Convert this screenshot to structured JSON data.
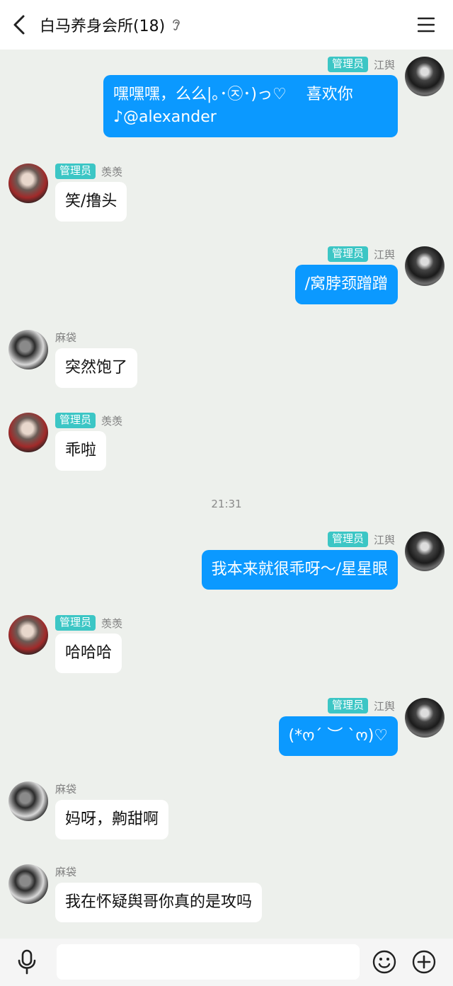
{
  "header": {
    "title": "白马养身会所(18)",
    "back_icon": "chevron-left-icon",
    "ear_icon": "ear-icon",
    "menu_icon": "hamburger-menu-icon"
  },
  "messages": [
    {
      "side": "right",
      "badge": "管理员",
      "name": "江舆",
      "text": "嘿嘿嘿，么么|｡･㉨･)っ♡    喜欢你\n♪@alexander"
    },
    {
      "side": "left",
      "badge": "管理员",
      "name": "羡羡",
      "text": "笑/撸头"
    },
    {
      "side": "right",
      "badge": "管理员",
      "name": "江舆",
      "text": "/窝脖颈蹭蹭"
    },
    {
      "side": "left",
      "name": "麻袋",
      "text": "突然饱了"
    },
    {
      "side": "left",
      "badge": "管理员",
      "name": "羡羡",
      "text": "乖啦"
    },
    {
      "side": "right",
      "badge": "管理员",
      "name": "江舆",
      "text": "我本来就很乖呀～/星星眼"
    },
    {
      "side": "left",
      "badge": "管理员",
      "name": "羡羡",
      "text": "哈哈哈"
    },
    {
      "side": "right",
      "badge": "管理员",
      "name": "江舆",
      "text": "(*ო´ ︶ `ო)♡"
    },
    {
      "side": "left",
      "name": "麻袋",
      "text": "妈呀，齁甜啊"
    },
    {
      "side": "left",
      "name": "麻袋",
      "text": "我在怀疑舆哥你真的是攻吗"
    }
  ],
  "timestamp": "21:31",
  "bottom": {
    "mic_icon": "microphone-icon",
    "emoji_icon": "smiley-icon",
    "plus_icon": "plus-circle-icon",
    "input_value": ""
  },
  "colors": {
    "background": "#edf0ec",
    "bubble_self": "#0b99ff",
    "bubble_other": "#ffffff",
    "badge": "#3cc6c5"
  }
}
